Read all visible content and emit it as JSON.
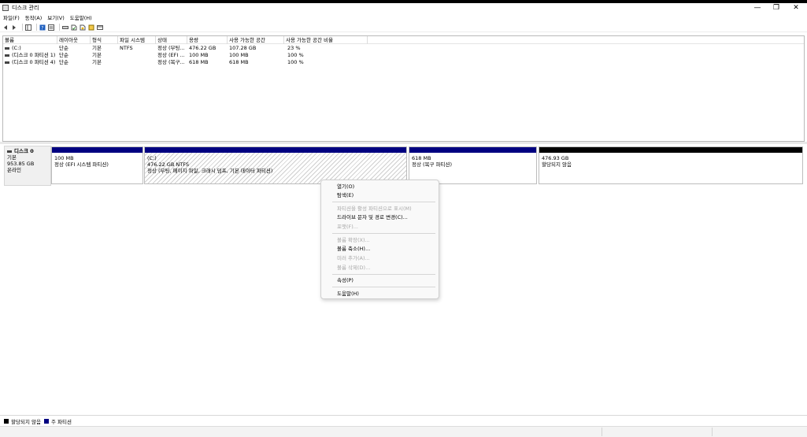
{
  "window": {
    "title": "디스크 관리",
    "controls": [
      "—",
      "❐",
      "✕"
    ]
  },
  "menu": [
    "파일(F)",
    "동작(A)",
    "보기(V)",
    "도움말(H)"
  ],
  "toolbar": {
    "icons": [
      "back-arrow-icon",
      "forward-arrow-icon",
      "console-tree-icon",
      "help-icon",
      "list-view-icon",
      "connect-drive-icon",
      "rescan-icon",
      "properties-icon",
      "new-icon",
      "settings-icon"
    ]
  },
  "volume_list": {
    "columns": [
      "볼륨",
      "레이아웃",
      "형식",
      "파일 시스템",
      "상태",
      "용량",
      "사용 가능한 공간",
      "사용 가능한 공간 비율"
    ],
    "rows": [
      [
        "(C:)",
        "단순",
        "기본",
        "NTFS",
        "정상 (부팅...",
        "476.22 GB",
        "107.28 GB",
        "23 %"
      ],
      [
        "(디스크 0 파티션 1)",
        "단순",
        "기본",
        "",
        "정상 (EFI ...",
        "100 MB",
        "100 MB",
        "100 %"
      ],
      [
        "(디스크 0 파티션 4)",
        "단순",
        "기본",
        "",
        "정상 (복구...",
        "618 MB",
        "618 MB",
        "100 %"
      ]
    ]
  },
  "disk": {
    "name": "디스크 0",
    "type": "기본",
    "size": "953.85 GB",
    "status": "온라인",
    "partitions": [
      {
        "line1": "",
        "line2": "100 MB",
        "line3": "정상 (EFI 시스템 파티션)",
        "kind": "primary"
      },
      {
        "line1": "(C:)",
        "line2": "476.22 GB NTFS",
        "line3": "정상 (부팅, 페이지 파일, 크래시 덤프, 기본 데이터 파티션)",
        "kind": "primary-selected"
      },
      {
        "line1": "",
        "line2": "618 MB",
        "line3": "정상 (복구 파티션)",
        "kind": "primary"
      },
      {
        "line1": "",
        "line2": "476.93 GB",
        "line3": "할당되지 않음",
        "kind": "unallocated"
      }
    ]
  },
  "context_menu": [
    {
      "label": "열기(O)",
      "enabled": true
    },
    {
      "label": "탐색(E)",
      "enabled": true
    },
    {
      "label": "파티션을 활성 파티션으로 표시(M)",
      "enabled": false
    },
    {
      "label": "드라이브 문자 및 경로 변경(C)...",
      "enabled": true
    },
    {
      "label": "포맷(F)...",
      "enabled": false
    },
    {
      "label": "볼륨 확장(X)...",
      "enabled": false
    },
    {
      "label": "볼륨 축소(H)...",
      "enabled": true
    },
    {
      "label": "미러 추가(A)...",
      "enabled": false
    },
    {
      "label": "볼륨 삭제(D)...",
      "enabled": false
    },
    {
      "label": "속성(P)",
      "enabled": true
    },
    {
      "label": "도움말(H)",
      "enabled": true
    }
  ],
  "legend": [
    {
      "label": "할당되지 않음",
      "color": "#000000"
    },
    {
      "label": "주 파티션",
      "color": "#000080"
    }
  ],
  "colors": {
    "primary_partition": "#000080",
    "unallocated": "#000000"
  }
}
